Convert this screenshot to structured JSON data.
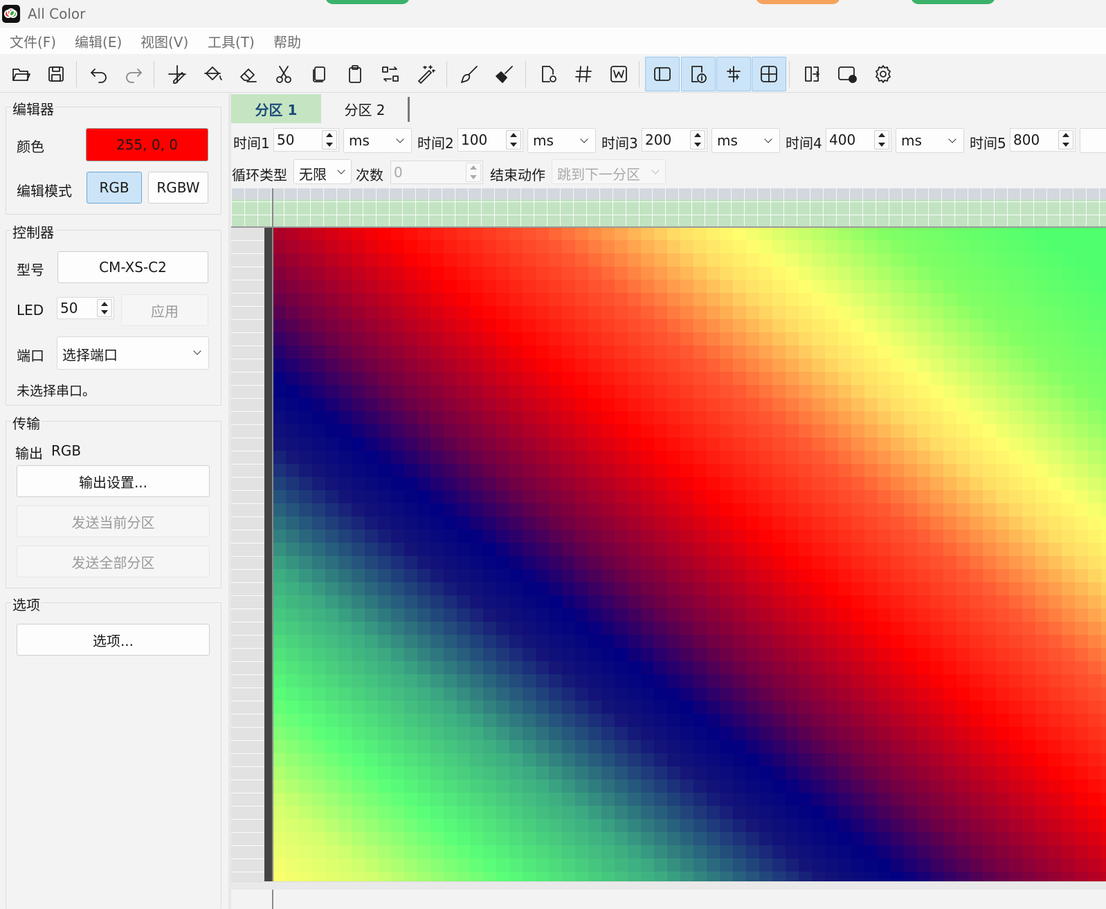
{
  "app": {
    "title": "All Color"
  },
  "colors": {
    "title_pill_1": "#3bb26a",
    "title_pill_2": "#f5a25d",
    "title_pill_3": "#3bb26a",
    "color_swatch": "#ff0000",
    "active_tab": "#c5e5c2"
  },
  "menu": [
    "文件(F)",
    "编辑(E)",
    "视图(V)",
    "工具(T)",
    "帮助"
  ],
  "toolbar": {
    "buttons": [
      {
        "icon": "open-folder-icon"
      },
      {
        "icon": "save-icon"
      },
      {
        "icon": "undo-icon"
      },
      {
        "icon": "redo-icon"
      },
      {
        "icon": "pencil-cursor-icon"
      },
      {
        "icon": "fill-bucket-icon"
      },
      {
        "icon": "eraser-icon"
      },
      {
        "icon": "cut-icon"
      },
      {
        "icon": "copy-icon"
      },
      {
        "icon": "paste-icon"
      },
      {
        "icon": "swap-icon"
      },
      {
        "icon": "magic-wand-icon"
      },
      {
        "icon": "brush-icon"
      },
      {
        "icon": "broom-icon"
      },
      {
        "icon": "page-settings-icon"
      },
      {
        "icon": "hash-grid-icon"
      },
      {
        "icon": "w-box-icon"
      },
      {
        "icon": "panel-left-icon",
        "active": true
      },
      {
        "icon": "info-page-icon",
        "active": true
      },
      {
        "icon": "align-icon",
        "active": true
      },
      {
        "icon": "grid-view-icon",
        "active": true
      },
      {
        "icon": "export-door-icon"
      },
      {
        "icon": "record-play-icon"
      },
      {
        "icon": "gear-icon"
      }
    ]
  },
  "editor": {
    "group_title": "编辑器",
    "color_label": "颜色",
    "color_value": "255, 0, 0",
    "mode_label": "编辑模式",
    "mode_rgb": "RGB",
    "mode_rgbw": "RGBW"
  },
  "controller": {
    "group_title": "控制器",
    "model_label": "型号",
    "model_value": "CM-XS-C2",
    "led_label": "LED",
    "led_value": "50",
    "apply_label": "应用",
    "port_label": "端口",
    "port_value": "选择端口",
    "status_text": "未选择串口。"
  },
  "transfer": {
    "group_title": "传输",
    "output_label": "输出",
    "output_value": "RGB",
    "output_settings": "输出设置...",
    "send_current": "发送当前分区",
    "send_all": "发送全部分区"
  },
  "options": {
    "group_title": "选项",
    "options_button": "选项..."
  },
  "tabs": [
    {
      "label": "分区 1",
      "selected": true
    },
    {
      "label": "分区 2",
      "selected": false
    }
  ],
  "timing": [
    {
      "label": "时间1",
      "value": "50",
      "unit": "ms"
    },
    {
      "label": "时间2",
      "value": "100",
      "unit": "ms"
    },
    {
      "label": "时间3",
      "value": "200",
      "unit": "ms"
    },
    {
      "label": "时间4",
      "value": "400",
      "unit": "ms"
    },
    {
      "label": "时间5",
      "value": "800",
      "unit": ""
    }
  ],
  "loop": {
    "type_label": "循环类型",
    "type_value": "无限",
    "count_label": "次数",
    "count_value": "0",
    "end_label": "结束动作",
    "end_value": "跳到下一分区"
  }
}
